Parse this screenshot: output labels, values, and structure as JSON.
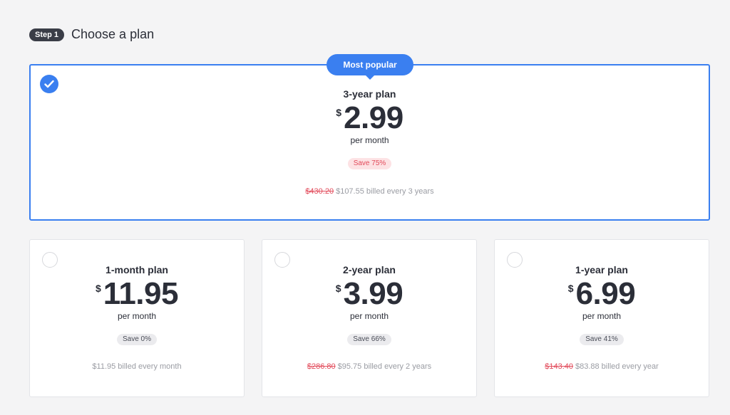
{
  "header": {
    "step_label": "Step 1",
    "title": "Choose a plan"
  },
  "featured_plan": {
    "badge": "Most popular",
    "name": "3-year plan",
    "currency": "$",
    "price": "2.99",
    "per": "per month",
    "save": "Save 75%",
    "original_price": "$430.20",
    "billing": "$107.55 billed every 3 years",
    "selected": true
  },
  "plans": [
    {
      "name": "1-month plan",
      "currency": "$",
      "price": "11.95",
      "per": "per month",
      "save": "Save 0%",
      "original_price": "",
      "billing": "$11.95 billed every month"
    },
    {
      "name": "2-year plan",
      "currency": "$",
      "price": "3.99",
      "per": "per month",
      "save": "Save 66%",
      "original_price": "$286.80",
      "billing": "$95.75 billed every 2 years"
    },
    {
      "name": "1-year plan",
      "currency": "$",
      "price": "6.99",
      "per": "per month",
      "save": "Save 41%",
      "original_price": "$143.40",
      "billing": "$83.88 billed every year"
    }
  ],
  "colors": {
    "accent": "#3a7ff0",
    "discount": "#e24a5a",
    "badge_dark": "#3a3d47"
  }
}
